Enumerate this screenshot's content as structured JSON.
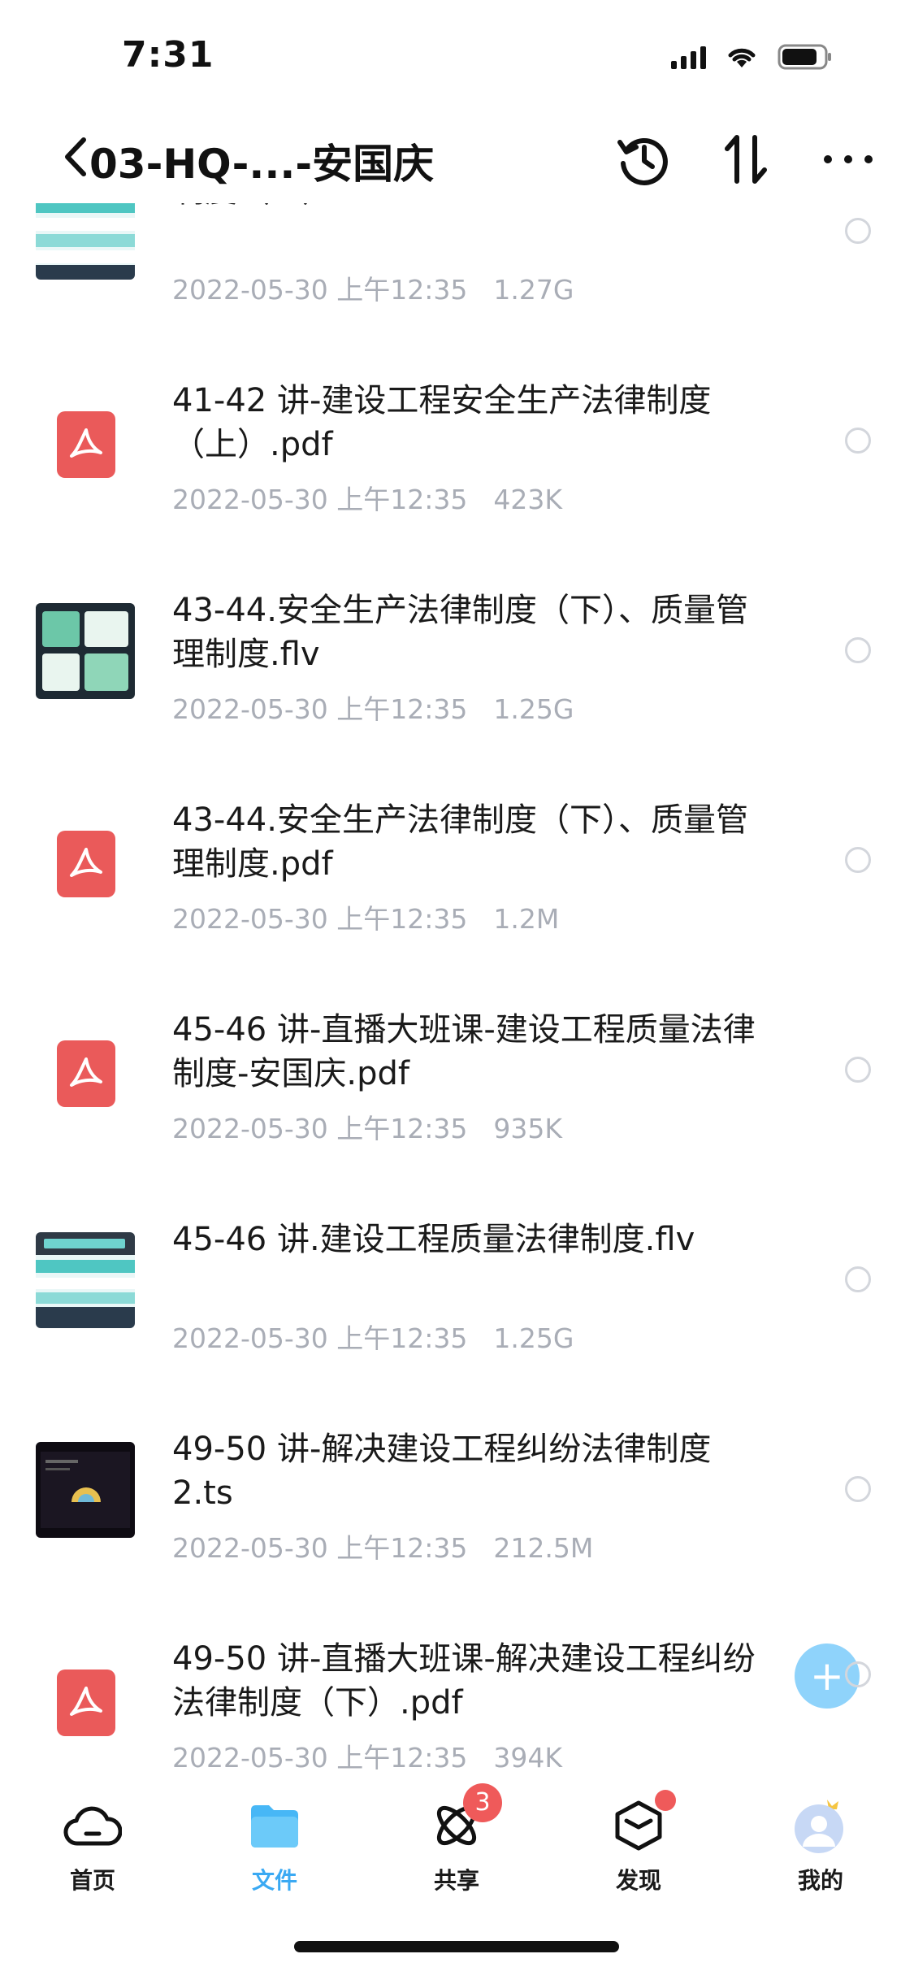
{
  "status_bar": {
    "time": "7:31"
  },
  "header": {
    "title": "03-HQ-...-安国庆",
    "icons": [
      "back-icon",
      "history-icon",
      "sort-icon",
      "more-icon"
    ]
  },
  "files": [
    {
      "name": "制度（上）.flv",
      "date": "2022-05-30 上午12:35",
      "size": "1.27G",
      "type": "video-thumb-table"
    },
    {
      "name": "41-42 讲-建设工程安全生产法律制度（上）.pdf",
      "date": "2022-05-30 上午12:35",
      "size": "423K",
      "type": "pdf"
    },
    {
      "name": "43-44.安全生产法律制度（下）、质量管理制度.flv",
      "date": "2022-05-30 上午12:35",
      "size": "1.25G",
      "type": "video-thumb-green"
    },
    {
      "name": "43-44.安全生产法律制度（下）、质量管理制度.pdf",
      "date": "2022-05-30 上午12:35",
      "size": "1.2M",
      "type": "pdf"
    },
    {
      "name": "45-46 讲-直播大班课-建设工程质量法律制度-安国庆.pdf",
      "date": "2022-05-30 上午12:35",
      "size": "935K",
      "type": "pdf"
    },
    {
      "name": "45-46 讲.建设工程质量法律制度.flv",
      "date": "2022-05-30 上午12:35",
      "size": "1.25G",
      "type": "video-thumb-table"
    },
    {
      "name": "49-50 讲-解决建设工程纠纷法律制度 2.ts",
      "date": "2022-05-30 上午12:35",
      "size": "212.5M",
      "type": "video-thumb-dark"
    },
    {
      "name": "49-50 讲-直播大班课-解决建设工程纠纷法律制度（下）.pdf",
      "date": "2022-05-30 上午12:35",
      "size": "394K",
      "type": "pdf"
    }
  ],
  "fab": {
    "icon": "plus-icon",
    "label": "+"
  },
  "tabbar": {
    "items": [
      {
        "label": "首页",
        "icon": "cloud-icon",
        "active": false
      },
      {
        "label": "文件",
        "icon": "folder-icon",
        "active": true
      },
      {
        "label": "共享",
        "icon": "share-orbit-icon",
        "active": false,
        "badge": "3"
      },
      {
        "label": "发现",
        "icon": "cube-icon",
        "active": false,
        "dot": true
      },
      {
        "label": "我的",
        "icon": "avatar-icon",
        "active": false
      }
    ]
  },
  "colors": {
    "accent": "#3aa9f3",
    "pdf": "#ea5a5a",
    "meta_text": "#a9adb6",
    "badge": "#ef5a5a",
    "fab": "#8fd3fb"
  }
}
